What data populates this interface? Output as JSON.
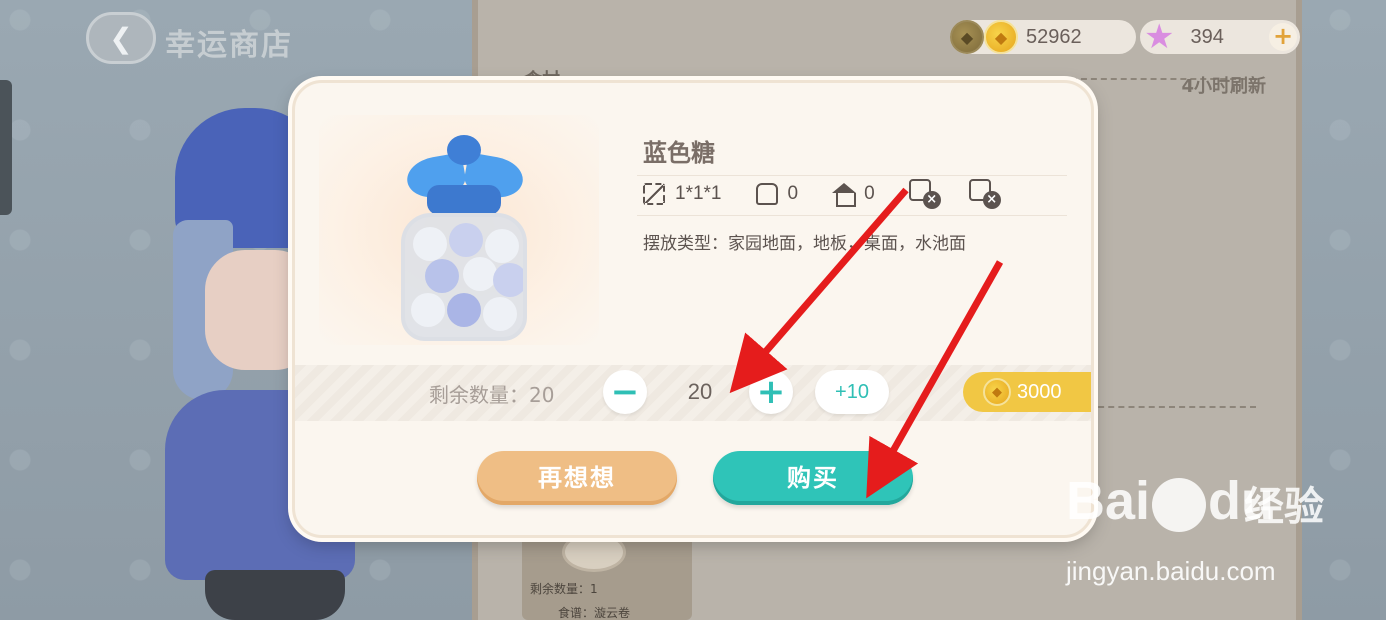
{
  "header": {
    "back_icon": "chevron-left-icon",
    "title": "幸运商店"
  },
  "currency": {
    "coin_value": "52962",
    "star_value": "394",
    "add_label": "+"
  },
  "shop": {
    "title_fragment": "食材",
    "refresh_text": "4小时刷新",
    "card_remain": "剩余数量：1",
    "card_name": "食谱：漩云卷"
  },
  "dialog": {
    "item_name": "蓝色糖",
    "stats": {
      "size": "1*1*1",
      "bag": "0",
      "house": "0"
    },
    "icons": [
      "size-icon",
      "backpack-icon",
      "house-icon",
      "no-sweep-icon",
      "no-trade-icon"
    ],
    "placement_text": "摆放类型：家园地面，地板，桌面，水池面",
    "remaining_label": "剩余数量：20",
    "quantity": "20",
    "minus_label": "−",
    "plus_label": "+",
    "plus_ten_label": "+10",
    "price": "3000",
    "rethink_label": "再想想",
    "buy_label": "购买"
  },
  "watermark": {
    "brand": "Bai",
    "brand_suffix": "du",
    "jingyan": "经验",
    "url": "jingyan.baidu.com"
  },
  "colors": {
    "accent": "#2fc4b8",
    "secondary_button": "#efbe85",
    "price_bg": "#f1c744",
    "arrow": "#e51c1c"
  }
}
